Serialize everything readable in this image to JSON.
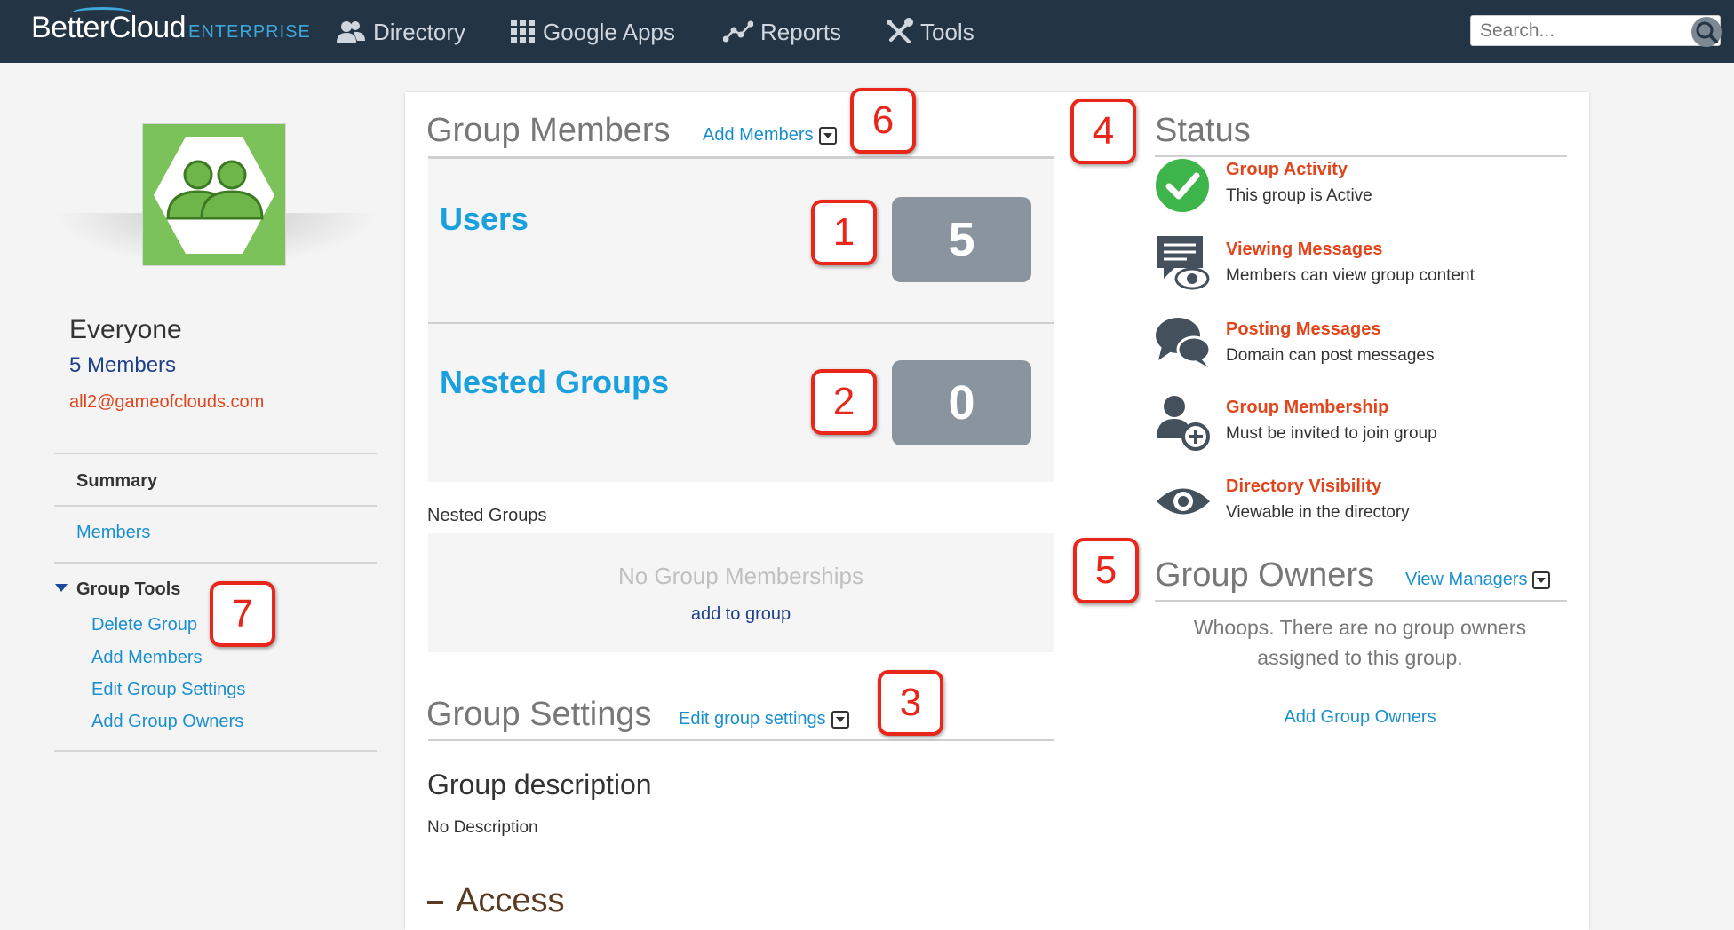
{
  "nav": {
    "logo_text": "BetterCloud",
    "logo_sub": "ENTERPRISE",
    "items": [
      {
        "label": "Directory",
        "icon": "users-icon"
      },
      {
        "label": "Google Apps",
        "icon": "grid-icon"
      },
      {
        "label": "Reports",
        "icon": "line-chart-icon"
      },
      {
        "label": "Tools",
        "icon": "tools-icon"
      }
    ],
    "search_placeholder": "Search..."
  },
  "sidebar": {
    "group_name": "Everyone",
    "member_count": "5 Members",
    "email": "all2@gameofclouds.com",
    "summary_label": "Summary",
    "members_label": "Members",
    "tools_label": "Group Tools",
    "tools": [
      "Delete Group",
      "Add Members",
      "Edit Group Settings",
      "Add Group Owners"
    ]
  },
  "members": {
    "title": "Group Members",
    "add_link": "Add Members",
    "users_label": "Users",
    "users_count": "5",
    "nested_label": "Nested Groups",
    "nested_count": "0",
    "nested_section_label": "Nested Groups",
    "empty_text": "No Group Memberships",
    "add_to_group": "add to group"
  },
  "settings": {
    "title": "Group Settings",
    "edit_link": "Edit group settings",
    "desc_title": "Group description",
    "desc_value": "No Description",
    "access_title": "Access"
  },
  "status": {
    "title": "Status",
    "items": [
      {
        "title": "Group Activity",
        "desc": "This group is Active",
        "icon": "check-circle-icon"
      },
      {
        "title": "Viewing Messages",
        "desc": "Members can view group content",
        "icon": "message-eye-icon"
      },
      {
        "title": "Posting Messages",
        "desc": "Domain can post messages",
        "icon": "chat-bubbles-icon"
      },
      {
        "title": "Group Membership",
        "desc": "Must be invited to join group",
        "icon": "user-plus-icon"
      },
      {
        "title": "Directory Visibility",
        "desc": "Viewable in the directory",
        "icon": "eye-icon"
      }
    ]
  },
  "owners": {
    "title": "Group Owners",
    "view_link": "View Managers",
    "empty_line1": "Whoops. There are no group owners",
    "empty_line2": "assigned to this group.",
    "add_link": "Add Group Owners"
  },
  "callouts": [
    "1",
    "2",
    "3",
    "4",
    "5",
    "6",
    "7"
  ],
  "colors": {
    "nav_bg": "#233445",
    "accent_blue": "#1aa0dc",
    "status_red": "#e2441b",
    "callout_red": "#e8261a",
    "count_box": "#8a949e",
    "avatar_green": "#7cc25a"
  }
}
